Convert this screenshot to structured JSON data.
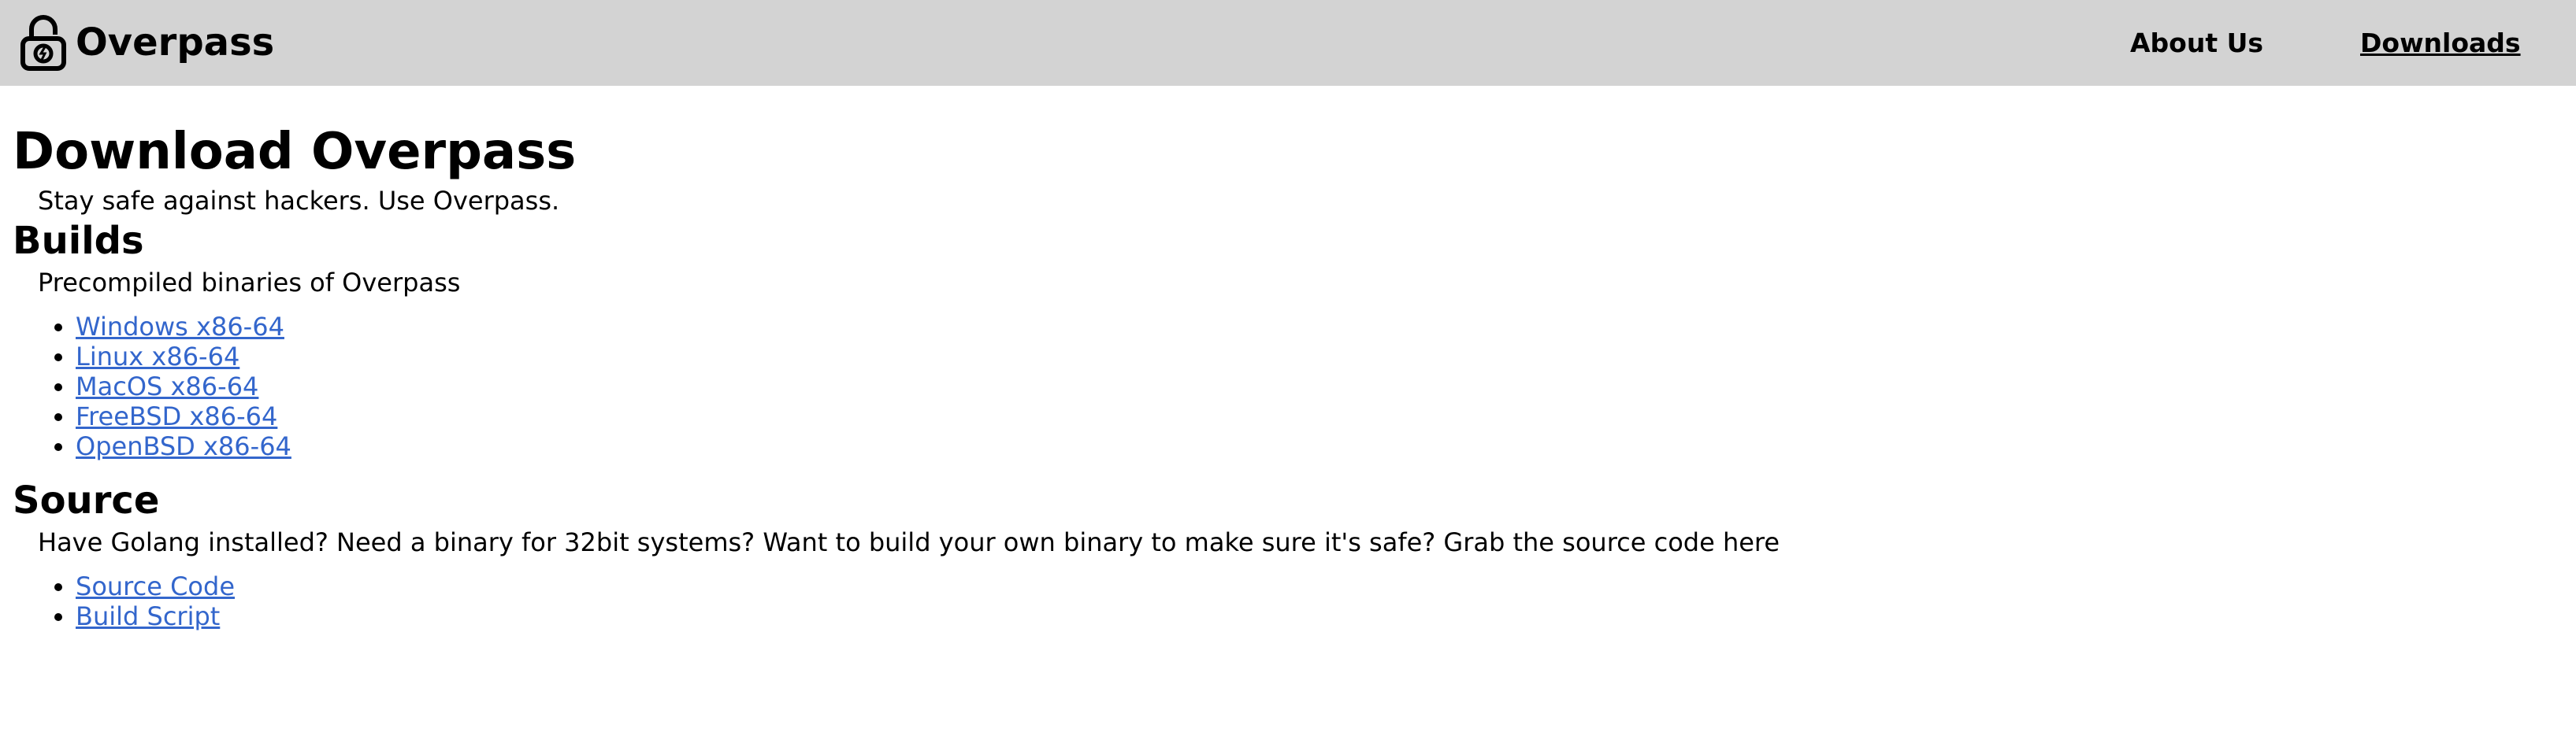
{
  "header": {
    "brand": "Overpass",
    "brand_icon": "padlock-icon",
    "nav": [
      {
        "label": "About Us"
      },
      {
        "label": "Downloads"
      }
    ]
  },
  "main": {
    "title": "Download Overpass",
    "tagline": "Stay safe against hackers. Use Overpass.",
    "builds": {
      "heading": "Builds",
      "description": "Precompiled binaries of Overpass",
      "links": [
        "Windows x86-64",
        "Linux x86-64",
        "MacOS x86-64",
        "FreeBSD x86-64",
        "OpenBSD x86-64"
      ]
    },
    "source": {
      "heading": "Source",
      "description": "Have Golang installed? Need a binary for 32bit systems? Want to build your own binary to make sure it's safe? Grab the source code here",
      "links": [
        "Source Code",
        "Build Script"
      ]
    }
  },
  "colors": {
    "header_bg": "#d3d3d3",
    "link": "#3366cc"
  }
}
